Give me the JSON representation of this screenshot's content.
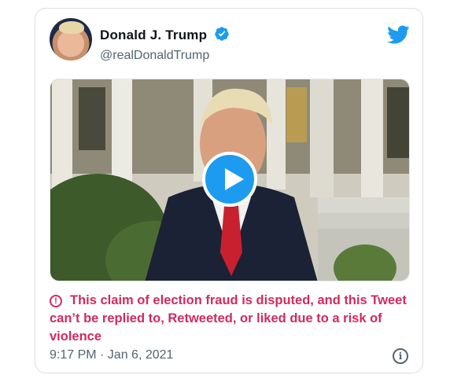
{
  "author": {
    "display_name": "Donald J. Trump",
    "handle": "@realDonaldTrump",
    "verified": true
  },
  "brand": {
    "icon": "twitter-bird-icon",
    "color": "#1d9bf0"
  },
  "media": {
    "type": "video",
    "play_icon": "play-icon"
  },
  "warning": {
    "icon": "exclamation-circle-icon",
    "text": "This claim of election fraud is disputed, and this Tweet can’t be replied to, Retweeted, or liked due to a risk of violence",
    "color": "#d12a5e"
  },
  "footer": {
    "timestamp": "9:17 PM · Jan 6, 2021",
    "info_icon": "info-icon"
  }
}
